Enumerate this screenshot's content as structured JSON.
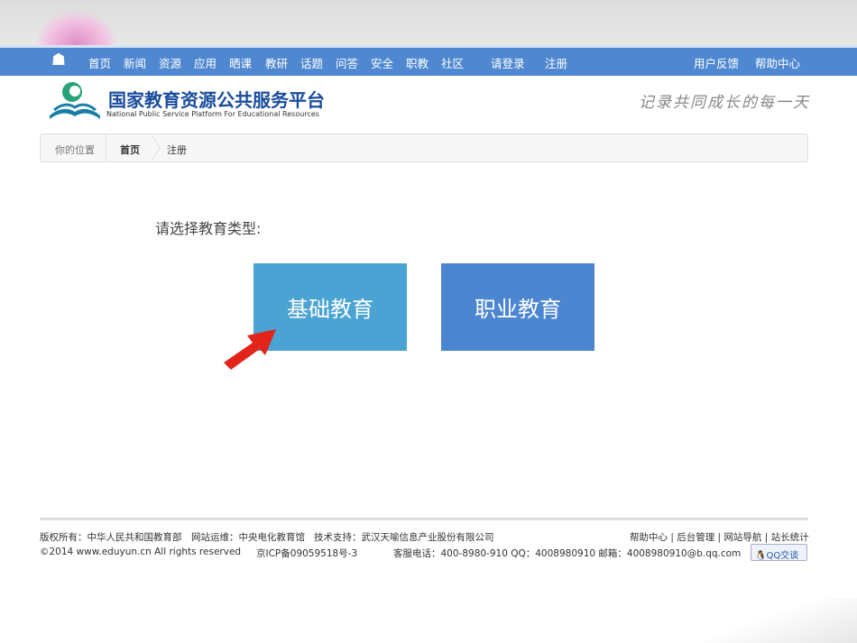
{
  "nav": {
    "items": [
      "首页",
      "新闻",
      "资源",
      "应用",
      "晒课",
      "教研",
      "话题",
      "问答",
      "安全",
      "职教",
      "社区"
    ],
    "login": "请登录",
    "register": "注册",
    "feedback": "用户反馈",
    "help": "帮助中心"
  },
  "header": {
    "title": "国家教育资源公共服务平台",
    "subtitle": "National Public Service Platform For Educational Resources",
    "slogan": "记录共同成长的每一天"
  },
  "breadcrumb": {
    "label": "你的位置",
    "home": "首页",
    "current": "注册"
  },
  "main": {
    "prompt": "请选择教育类型:",
    "options": [
      "基础教育",
      "职业教育"
    ],
    "colors": [
      "#4aa3d2",
      "#4c86d1"
    ]
  },
  "footer": {
    "copyright_owner": "版权所有：中华人民共和国教育部",
    "operator": "网站运维：中央电化教育馆",
    "support": "技术支持：武汉天喻信息产业股份有限公司",
    "links": [
      "帮助中心",
      "后台管理",
      "网站导航",
      "站长统计"
    ],
    "copyright": "©2014 www.eduyun.cn All rights reserved",
    "icp": "京ICP备09059518号-3",
    "contact": "客服电话：400-8980-910 QQ：4008980910 邮箱：4008980910@b.qq.com",
    "qq_button": "QQ交谈"
  }
}
